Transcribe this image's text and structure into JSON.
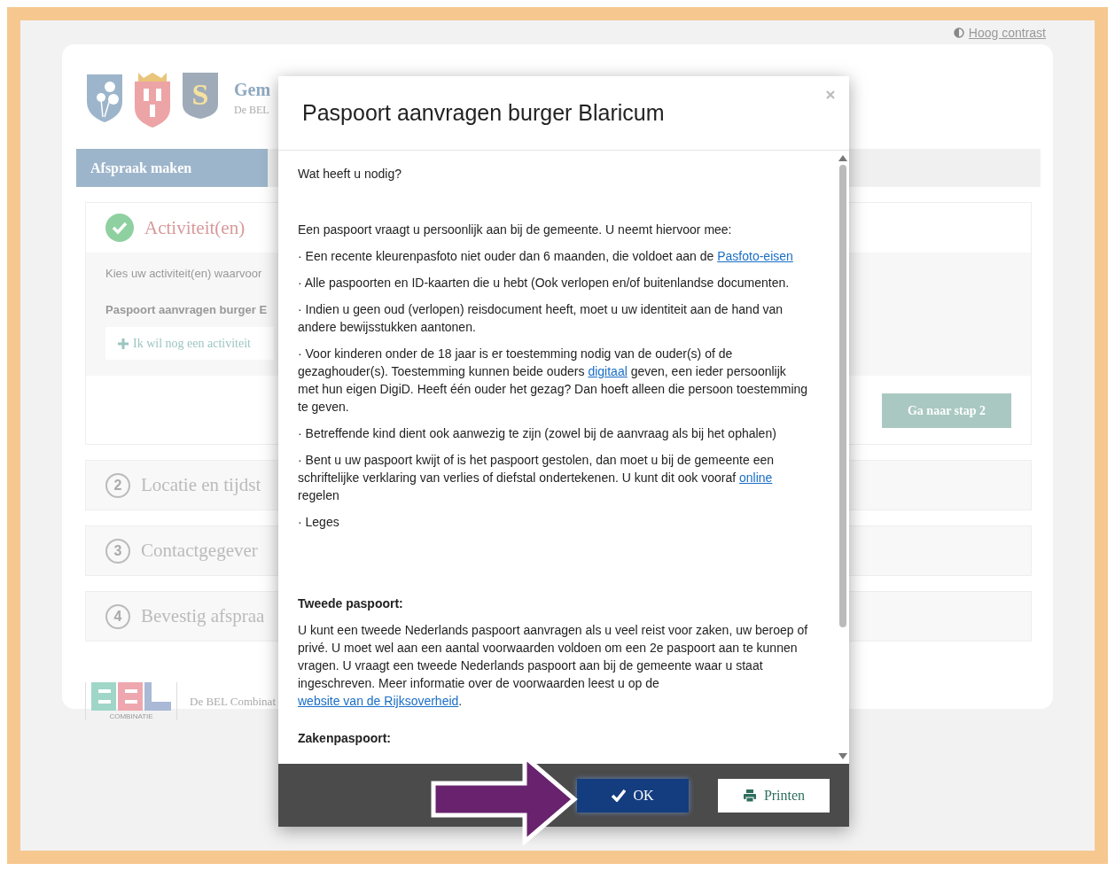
{
  "contrast_link": "Hoog contrast",
  "header": {
    "crest_letter": "S",
    "title": "Gem",
    "subtitle": "De BEL"
  },
  "nav": {
    "tabs": [
      {
        "label": "Afspraak maken",
        "selected": true
      }
    ]
  },
  "steps": [
    {
      "kind": "done",
      "title": "Activiteit(en)"
    },
    {
      "kind": "pending",
      "number": "2",
      "title": "Locatie en tijdst"
    },
    {
      "kind": "pending",
      "number": "3",
      "title": "Contactgegever"
    },
    {
      "kind": "pending",
      "number": "4",
      "title": "Bevestig afspraa"
    }
  ],
  "activity_panel": {
    "intro": "Kies uw activiteit(en) waarvoor",
    "selected_activity": "Paspoort aanvragen burger E",
    "add_button": "Ik wil nog een activiteit",
    "next_button": "Ga naar stap 2"
  },
  "footer": {
    "logo_caption": "COMBINATIE",
    "text": "De BEL Combinat"
  },
  "modal": {
    "title": "Paspoort aanvragen burger Blaricum",
    "paragraphs": [
      {
        "kind": "lead",
        "parts": [
          {
            "kind": "text",
            "text": "Wat heeft u nodig?"
          }
        ]
      },
      {
        "kind": "text",
        "parts": [
          {
            "kind": "text",
            "text": "Een paspoort vraagt u persoonlijk aan bij de gemeente. U neemt hiervoor mee:"
          }
        ]
      },
      {
        "kind": "text",
        "parts": [
          {
            "kind": "text",
            "text": "·   Een recente kleurenpasfoto niet ouder dan 6 maanden, die voldoet aan de "
          },
          {
            "kind": "link",
            "text": "Pasfoto-eisen"
          }
        ]
      },
      {
        "kind": "text",
        "parts": [
          {
            "kind": "text",
            "text": "·    Alle paspoorten en ID-kaarten die u hebt (Ook verlopen en/of buitenlandse documenten."
          }
        ]
      },
      {
        "kind": "text",
        "parts": [
          {
            "kind": "text",
            "text": "·    Indien u geen oud (verlopen) reisdocument heeft, moet u uw identiteit aan de hand van andere bewijsstukken aantonen."
          }
        ]
      },
      {
        "kind": "text",
        "parts": [
          {
            "kind": "text",
            "text": "·    Voor kinderen onder de 18 jaar is er toestemming nodig van de ouder(s) of de gezaghouder(s). Toestemming kunnen beide ouders "
          },
          {
            "kind": "link",
            "text": "digitaal"
          },
          {
            "kind": "text",
            "text": " geven, een ieder persoonlijk met hun eigen DigiD. Heeft één ouder het gezag? Dan hoeft alleen die persoon toestemming te geven."
          }
        ]
      },
      {
        "kind": "text",
        "parts": [
          {
            "kind": "text",
            "text": "·    Betreffende kind dient ook aanwezig te zijn (zowel bij de aanvraag als bij het ophalen)"
          }
        ]
      },
      {
        "kind": "text",
        "parts": [
          {
            "kind": "text",
            "text": "·    Bent u uw paspoort kwijt of is het paspoort gestolen, dan moet u bij de gemeente een schriftelijke verklaring van verlies of diefstal ondertekenen. U kunt dit ook vooraf "
          },
          {
            "kind": "link",
            "text": "online"
          },
          {
            "kind": "text",
            "text": " regelen"
          }
        ]
      },
      {
        "kind": "text",
        "parts": [
          {
            "kind": "text",
            "text": "·    Leges"
          }
        ]
      },
      {
        "kind": "heading",
        "parts": [
          {
            "kind": "text",
            "text": "Tweede paspoort:"
          }
        ]
      },
      {
        "kind": "text",
        "parts": [
          {
            "kind": "text",
            "text": "U kunt een tweede Nederlands paspoort aanvragen als u veel reist voor zaken, uw beroep of privé. U moet wel aan een aantal voorwaarden voldoen om een 2e paspoort aan te kunnen vragen. U vraagt een tweede Nederlands paspoort aan bij de gemeente waar u staat ingeschreven. Meer informatie over de voorwaarden leest u op de "
          },
          {
            "kind": "link",
            "text": "website van de "
          },
          {
            "kind": "link",
            "text": "Rijksoverheid"
          },
          {
            "kind": "text",
            "text": "."
          }
        ]
      },
      {
        "kind": "heading2",
        "parts": [
          {
            "kind": "text",
            "text": "Zakenpaspoort:"
          }
        ]
      }
    ],
    "buttons": [
      {
        "kind": "primary",
        "label": "OK"
      },
      {
        "kind": "print",
        "label": "Printen"
      }
    ]
  }
}
